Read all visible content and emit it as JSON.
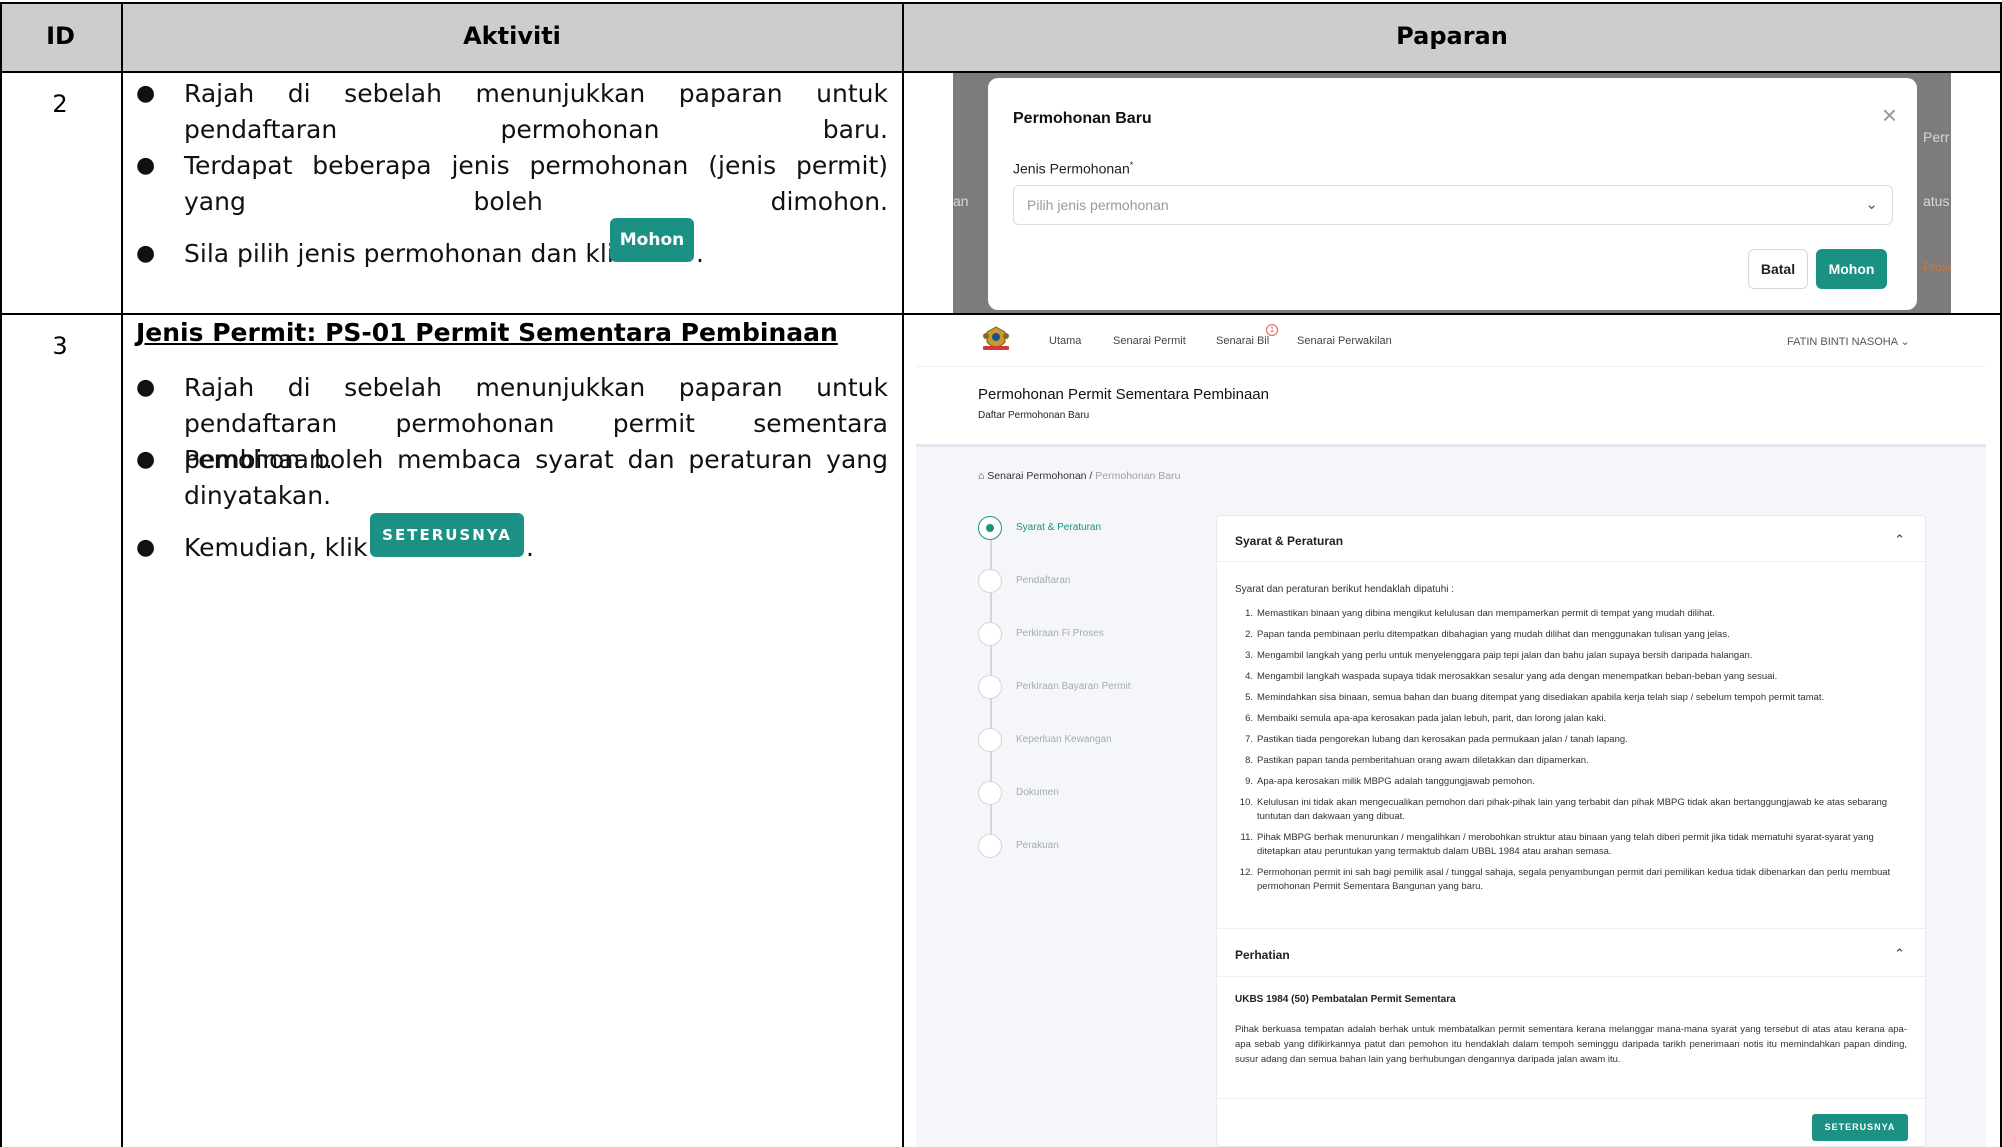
{
  "table": {
    "headers": {
      "id": "ID",
      "aktiviti": "Aktiviti",
      "paparan": "Paparan"
    },
    "row2": {
      "id": "2",
      "bullets": [
        "Rajah di sebelah menunjukkan paparan untuk pendaftaran permohonan baru.",
        "Terdapat beberapa jenis permohonan (jenis permit) yang boleh dimohon.",
        "Sila pilih jenis permohonan dan klik"
      ],
      "button": "Mohon",
      "suffix": "."
    },
    "row3": {
      "id": "3",
      "title": "Jenis Permit: PS-01 Permit Sementara Pembinaan",
      "bullets": [
        "Rajah di sebelah menunjukkan paparan untuk pendaftaran permohonan permit sementara pembinaan.",
        "Pemohon boleh membaca syarat dan peraturan yang dinyatakan.",
        "Kemudian, klik"
      ],
      "button": "SETERUSNYA",
      "suffix": "."
    }
  },
  "modal": {
    "title": "Permohonan Baru",
    "close_icon": "close-icon",
    "field_label": "Jenis Permohonan",
    "required_mark": "*",
    "placeholder": "Pilih jenis permohonan",
    "cancel": "Batal",
    "submit": "Mohon",
    "background_fragments": {
      "left": "an",
      "right_top": "Perr",
      "right_mid": "atus",
      "right_bottom": "Prose"
    }
  },
  "app": {
    "nav": [
      "Utama",
      "Senarai Permit",
      "Senarai Bil",
      "Senarai Perwakilan"
    ],
    "bil_badge": "1",
    "user": "FATIN BINTI NASOHA",
    "page_title": "Permohonan Permit Sementara Pembinaan",
    "page_subtitle": "Daftar Permohonan Baru",
    "breadcrumb": {
      "home": "Senarai Permohonan",
      "sep": "/",
      "current": "Permohonan Baru"
    },
    "steps": [
      "Syarat & Peraturan",
      "Pendaftaran",
      "Perkiraan Fi Proses",
      "Perkiraan Bayaran Permit",
      "Keperluan Kewangan",
      "Dokumen",
      "Perakuan"
    ],
    "active_step": 0,
    "section1_title": "Syarat & Peraturan",
    "intro": "Syarat dan peraturan berikut hendaklah dipatuhi :",
    "rules": [
      "Memastikan binaan yang dibina mengikut kelulusan dan mempamerkan permit di tempat yang mudah dilihat.",
      "Papan tanda pembinaan perlu ditempatkan dibahagian yang mudah dilihat dan menggunakan tulisan yang jelas.",
      "Mengambil langkah yang perlu untuk menyelenggara paip tepi jalan dan bahu jalan supaya bersih daripada halangan.",
      "Mengambil langkah waspada supaya tidak merosakkan sesalur yang ada dengan menempatkan beban-beban yang sesuai.",
      "Memindahkan sisa binaan, semua bahan dan buang ditempat yang disediakan apabila kerja telah siap / sebelum tempoh permit tamat.",
      "Membaiki semula apa-apa kerosakan pada jalan lebuh, parit, dan lorong jalan kaki.",
      "Pastikan tiada pengorekan lubang dan kerosakan pada permukaan jalan / tanah lapang.",
      "Pastikan papan tanda pemberitahuan orang awam diletakkan dan dipamerkan.",
      "Apa-apa kerosakan milik MBPG adalah tanggungjawab pemohon.",
      "Kelulusan ini tidak akan mengecualikan pemohon dari pihak-pihak lain yang terbabit dan pihak MBPG tidak akan bertanggungjawab ke atas sebarang tuntutan dan dakwaan yang dibuat.",
      "Pihak MBPG berhak menurunkan / mengalihkan / merobohkan struktur atau binaan yang telah diberi permit jika tidak mematuhi syarat-syarat yang ditetapkan atau peruntukan yang termaktub dalam UBBL 1984 atau arahan semasa.",
      "Permohonan permit ini sah bagi pemilik asal / tunggal sahaja, segala penyambungan permit dari pemilikan kedua tidak dibenarkan dan perlu membuat permohonan Permit Sementara Bangunan yang baru."
    ],
    "section2_title": "Perhatian",
    "ukbs_title": "UKBS 1984 (50) Pembatalan Permit Sementara",
    "perhatian_text": "Pihak berkuasa tempatan adalah berhak untuk membatalkan permit sementara kerana melanggar mana-mana syarat yang tersebut di atas atau kerana apa-apa sebab yang difikirkannya patut dan pemohon itu hendaklah dalam tempoh seminggu daripada tarikh penerimaan notis itu memindahkan papan dinding, susur adang dan semua bahan lain yang berhubungan dengannya daripada jalan awam itu.",
    "next_button": "SETERUSNYA",
    "colors": {
      "accent": "#1a9183",
      "header_bg": "#cdcdcd"
    }
  }
}
